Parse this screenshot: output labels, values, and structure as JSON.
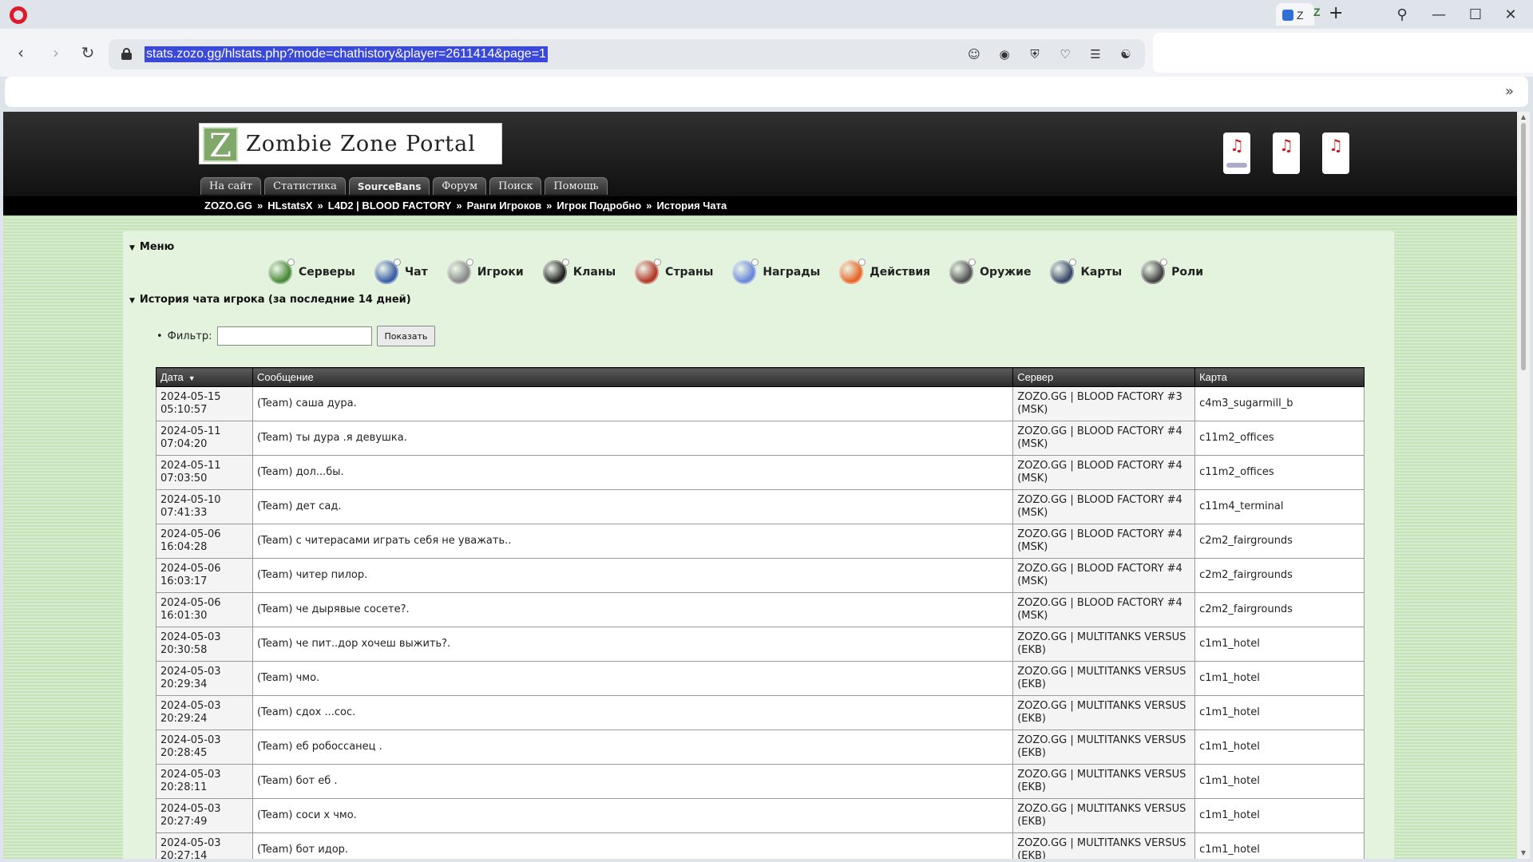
{
  "browser": {
    "tab_letter_1": "Z",
    "tab_letter_2": "Z",
    "url": "stats.zozo.gg/hlstats.php?mode=chathistory&player=2611414&page=1",
    "colors": {
      "opera_red": "#e0182c",
      "url_highlight": "#3a49d8"
    }
  },
  "site": {
    "logo_letter": "Z",
    "logo_text": "Zombie Zone Portal",
    "nav": [
      "На сайт",
      "Статистика",
      "SourceBans",
      "Форум",
      "Поиск",
      "Помощь"
    ],
    "breadcrumb": [
      "ZOZO.GG",
      "HLstatsX",
      "L4D2 | BLOOD FACTORY",
      "Ранги Игроков",
      "Игрок Подробно",
      "История Чата"
    ],
    "breadcrumb_sep": "»"
  },
  "menu": {
    "title": "Меню",
    "items": [
      {
        "label": "Серверы",
        "icon": "servers-icon",
        "color": "#4b8a3a"
      },
      {
        "label": "Чат",
        "icon": "chat-icon",
        "color": "#3b5fa6"
      },
      {
        "label": "Игроки",
        "icon": "players-icon",
        "color": "#8a8a8a"
      },
      {
        "label": "Кланы",
        "icon": "clans-icon",
        "color": "#222222"
      },
      {
        "label": "Страны",
        "icon": "countries-icon",
        "color": "#b23a2a"
      },
      {
        "label": "Награды",
        "icon": "awards-icon",
        "color": "#6a8ad8"
      },
      {
        "label": "Действия",
        "icon": "actions-icon",
        "color": "#e8662a"
      },
      {
        "label": "Оружие",
        "icon": "weapons-icon",
        "color": "#555555"
      },
      {
        "label": "Карты",
        "icon": "maps-icon",
        "color": "#3a4a6a"
      },
      {
        "label": "Роли",
        "icon": "roles-icon",
        "color": "#444444"
      }
    ]
  },
  "history": {
    "title": "История чата игрока (за последние 14 дней)",
    "filter_label": "Фильтр:",
    "filter_value": "",
    "show_button": "Показать",
    "columns": [
      "Дата",
      "Сообщение",
      "Сервер",
      "Карта"
    ],
    "sort_indicator": "▼",
    "rows": [
      {
        "date": "2024-05-15 05:10:57",
        "message": "(Team) саша дура.",
        "server": "ZOZO.GG | BLOOD FACTORY #3 (MSK)",
        "map": "c4m3_sugarmill_b"
      },
      {
        "date": "2024-05-11 07:04:20",
        "message": "(Team) ты дура .я девушка.",
        "server": "ZOZO.GG | BLOOD FACTORY #4 (MSK)",
        "map": "c11m2_offices"
      },
      {
        "date": "2024-05-11 07:03:50",
        "message": "(Team) дол...бы.",
        "server": "ZOZO.GG | BLOOD FACTORY #4 (MSK)",
        "map": "c11m2_offices"
      },
      {
        "date": "2024-05-10 07:41:33",
        "message": "(Team) дет сад.",
        "server": "ZOZO.GG | BLOOD FACTORY #4 (MSK)",
        "map": "c11m4_terminal"
      },
      {
        "date": "2024-05-06 16:04:28",
        "message": "(Team) с читерасами играть себя не уважать..",
        "server": "ZOZO.GG | BLOOD FACTORY #4 (MSK)",
        "map": "c2m2_fairgrounds"
      },
      {
        "date": "2024-05-06 16:03:17",
        "message": "(Team) читер пилор.",
        "server": "ZOZO.GG | BLOOD FACTORY #4 (MSK)",
        "map": "c2m2_fairgrounds"
      },
      {
        "date": "2024-05-06 16:01:30",
        "message": "(Team) че дырявые сосете?.",
        "server": "ZOZO.GG | BLOOD FACTORY #4 (MSK)",
        "map": "c2m2_fairgrounds"
      },
      {
        "date": "2024-05-03 20:30:58",
        "message": "(Team) че пит..дор хочеш выжить?.",
        "server": "ZOZO.GG | MULTITANKS VERSUS (EKB)",
        "map": "c1m1_hotel"
      },
      {
        "date": "2024-05-03 20:29:34",
        "message": "(Team) чмо.",
        "server": "ZOZO.GG | MULTITANKS VERSUS (EKB)",
        "map": "c1m1_hotel"
      },
      {
        "date": "2024-05-03 20:29:24",
        "message": "(Team) сдох ...сос.",
        "server": "ZOZO.GG | MULTITANKS VERSUS (EKB)",
        "map": "c1m1_hotel"
      },
      {
        "date": "2024-05-03 20:28:45",
        "message": "(Team) еб робоссанец .",
        "server": "ZOZO.GG | MULTITANKS VERSUS (EKB)",
        "map": "c1m1_hotel"
      },
      {
        "date": "2024-05-03 20:28:11",
        "message": "(Team) бот еб .",
        "server": "ZOZO.GG | MULTITANKS VERSUS (EKB)",
        "map": "c1m1_hotel"
      },
      {
        "date": "2024-05-03 20:27:49",
        "message": "(Team) соси х чмо.",
        "server": "ZOZO.GG | MULTITANKS VERSUS (EKB)",
        "map": "c1m1_hotel"
      },
      {
        "date": "2024-05-03 20:27:14",
        "message": "(Team) бот идор.",
        "server": "ZOZO.GG | MULTITANKS VERSUS (EKB)",
        "map": "c1m1_hotel"
      }
    ]
  }
}
